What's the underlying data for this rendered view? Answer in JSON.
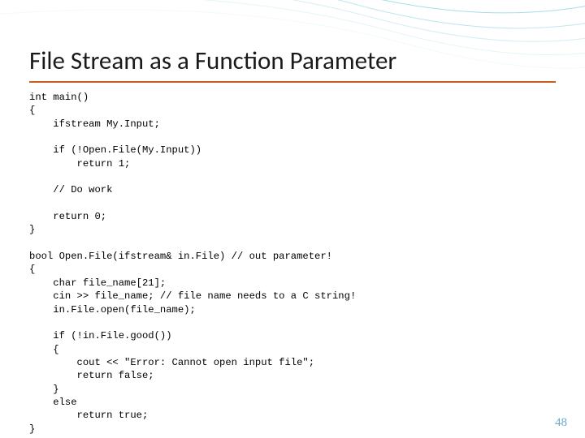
{
  "title": "File Stream as a Function Parameter",
  "code": "int main()\n{\n    ifstream My.Input;\n\n    if (!Open.File(My.Input))\n        return 1;\n\n    // Do work\n\n    return 0;\n}\n\nbool Open.File(ifstream& in.File) // out parameter!\n{\n    char file_name[21];\n    cin >> file_name; // file name needs to a C string!\n    in.File.open(file_name);\n\n    if (!in.File.good())\n    {\n        cout << \"Error: Cannot open input file\";\n        return false;\n    }\n    else\n        return true;\n}",
  "page_number": "48"
}
